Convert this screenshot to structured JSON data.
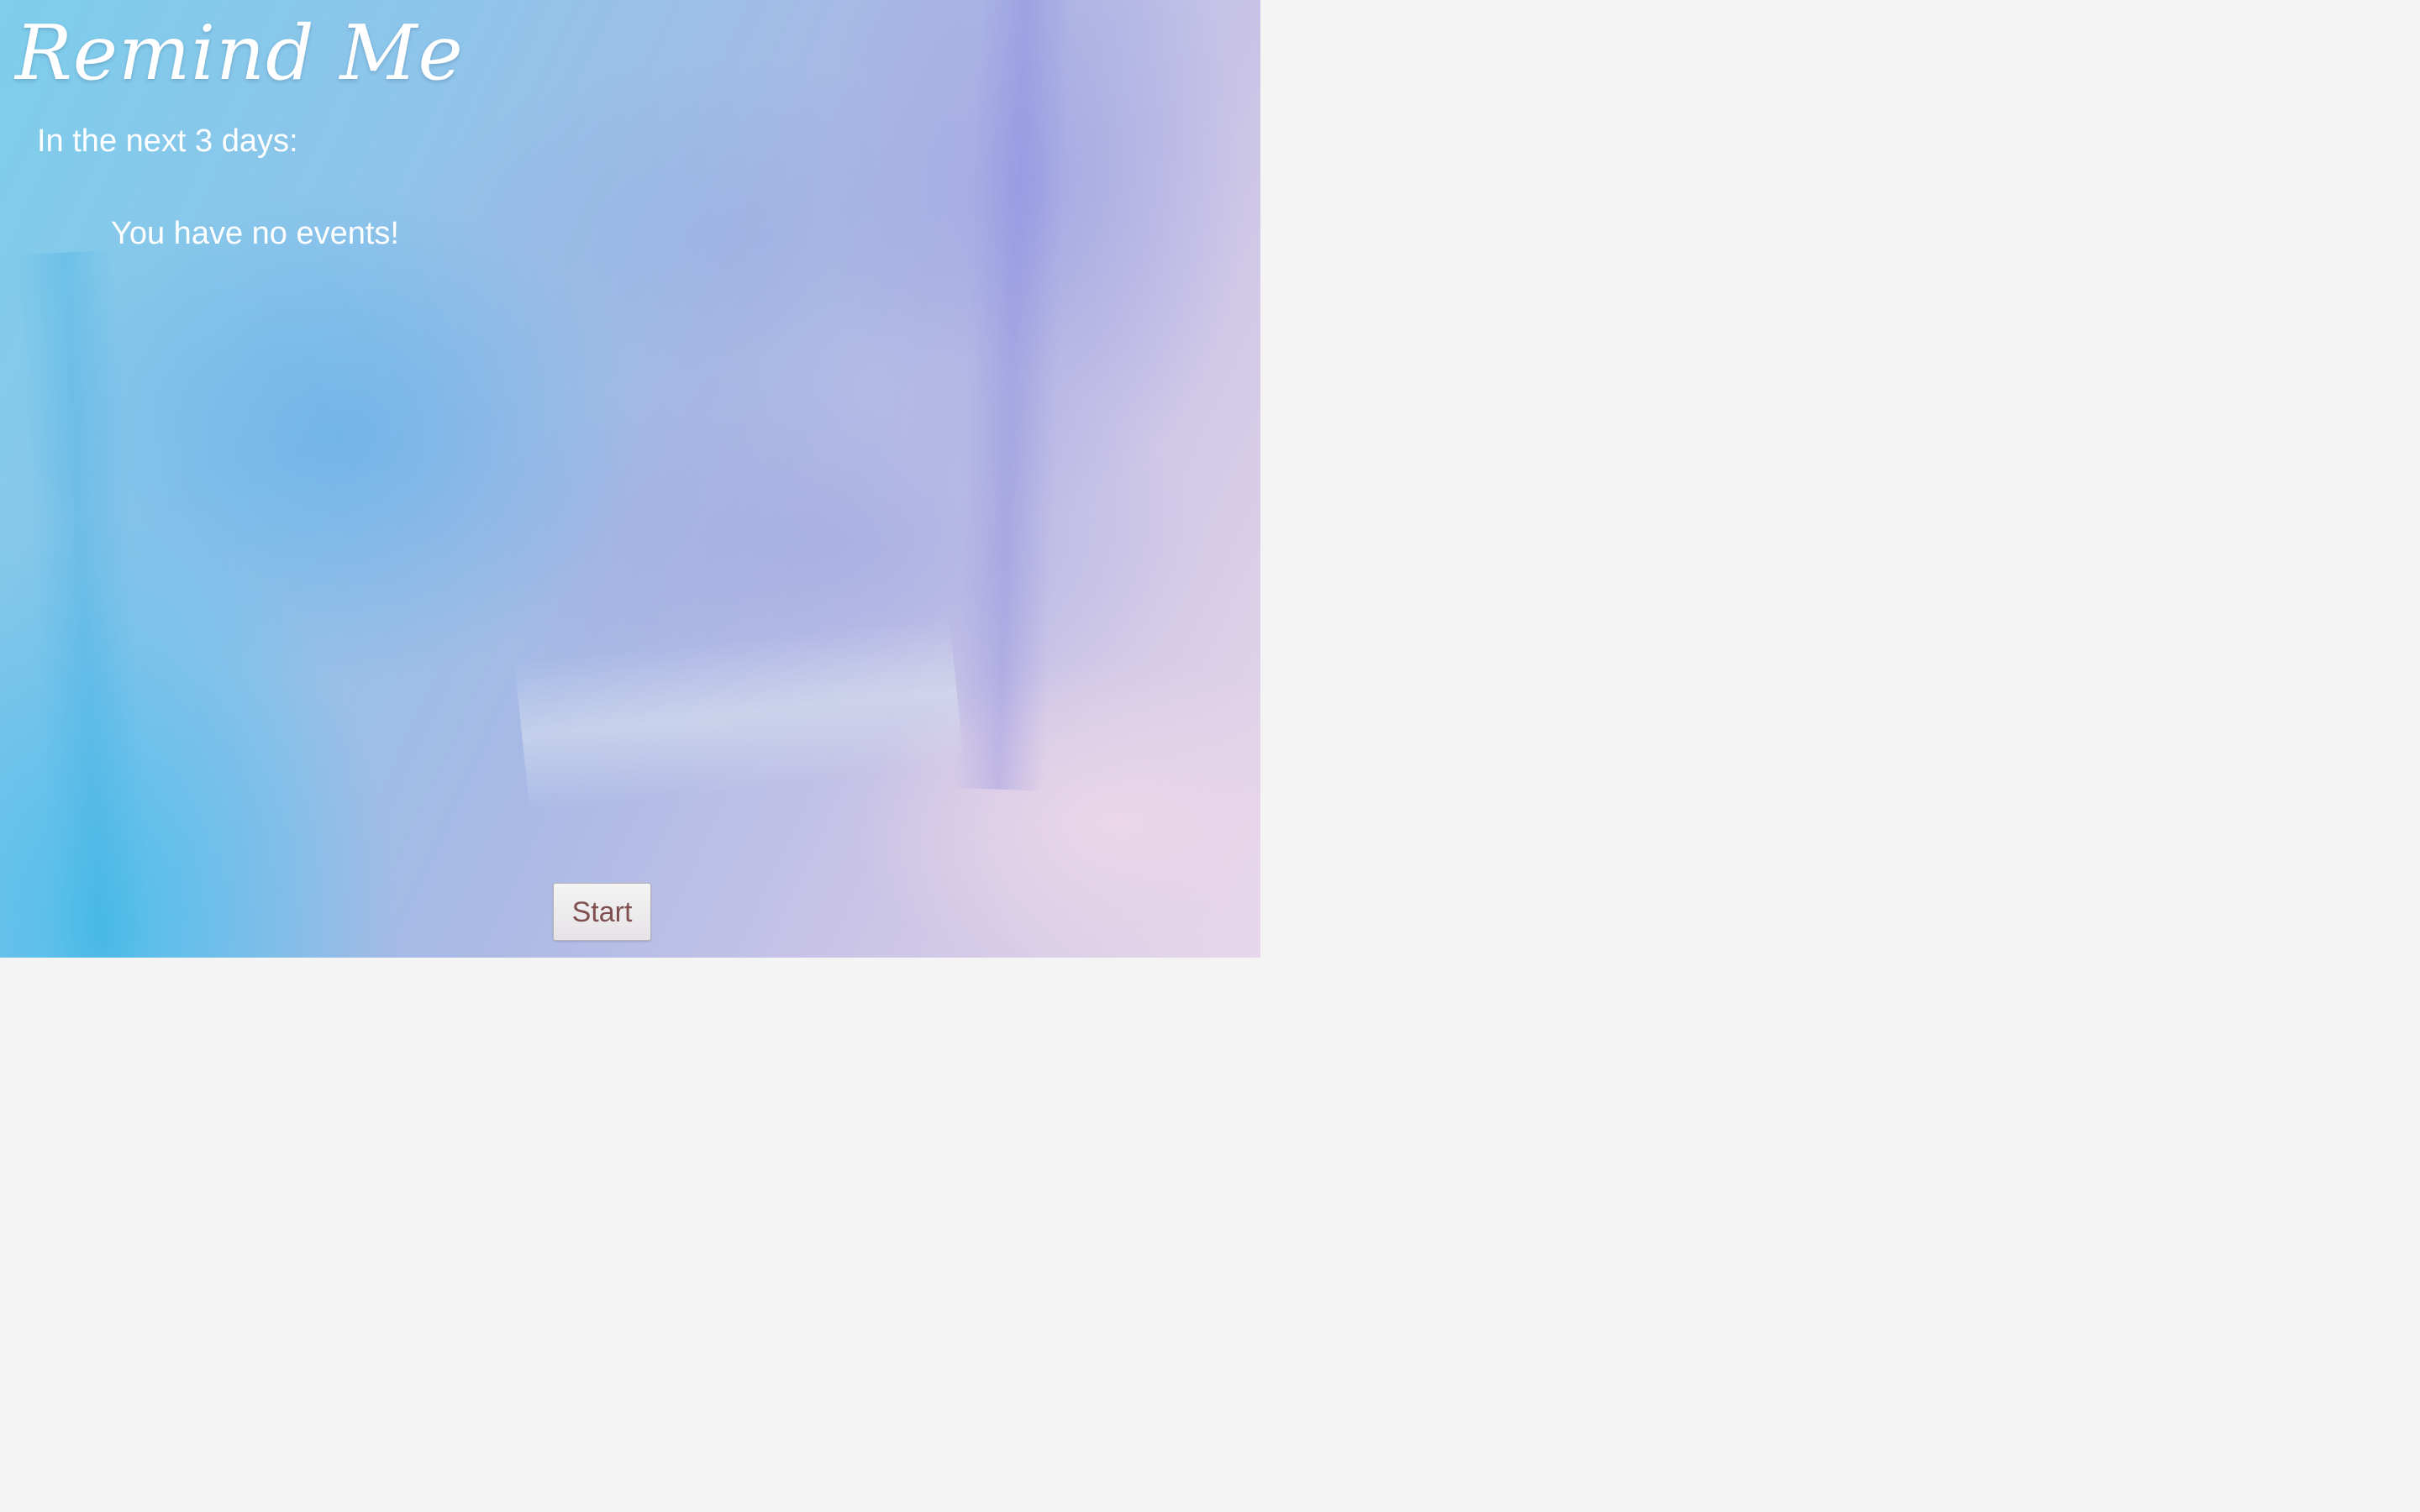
{
  "app": {
    "title": "Remind Me"
  },
  "upcoming": {
    "heading": "In the next 3 days:",
    "empty_message": "You have no events!"
  },
  "actions": {
    "start_label": "Start"
  },
  "colors": {
    "page_background": "#f4f4f4",
    "text": "#ffffff",
    "button_text": "#805050"
  }
}
